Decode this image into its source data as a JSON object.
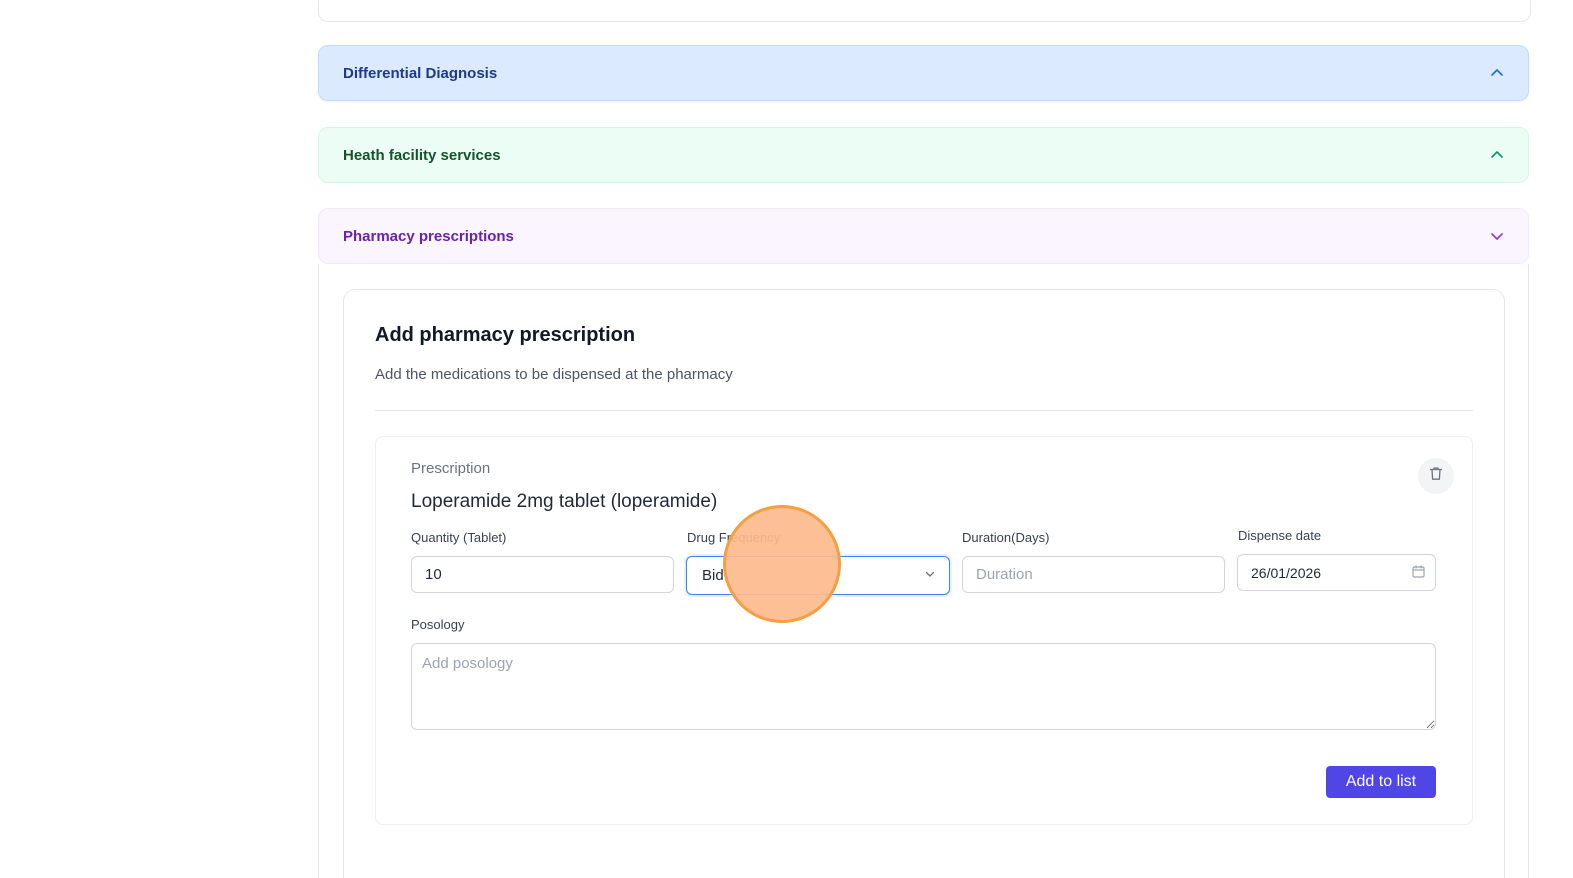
{
  "sections": {
    "differential_diagnosis": {
      "title": "Differential Diagnosis",
      "state": "collapsed"
    },
    "health_facility_services": {
      "title": "Heath facility services",
      "state": "collapsed"
    },
    "pharmacy_prescriptions": {
      "title": "Pharmacy prescriptions",
      "state": "expanded"
    }
  },
  "pharmacy": {
    "card_title": "Add pharmacy prescription",
    "card_subtitle": "Add the medications to be dispensed at the pharmacy",
    "prescription": {
      "label": "Prescription",
      "drug_name": "Loperamide 2mg tablet (loperamide)",
      "quantity": {
        "label": "Quantity (Tablet)",
        "value": "10"
      },
      "frequency": {
        "label": "Drug Frequency",
        "selected": "Bid"
      },
      "duration": {
        "label": "Duration(Days)",
        "placeholder": "Duration",
        "value": ""
      },
      "dispense_date": {
        "label": "Dispense date",
        "value": "26/01/2026"
      },
      "posology": {
        "label": "Posology",
        "placeholder": "Add posology",
        "value": ""
      }
    },
    "add_button_label": "Add to list"
  },
  "icons": {
    "collapse": "chevron-up-icon",
    "expand": "chevron-down-icon",
    "delete": "trash-icon",
    "calendar": "calendar-icon",
    "select": "chevron-down-icon"
  },
  "colors": {
    "diagnosis_bg": "#dbeafe",
    "diagnosis_text": "#1e3a8a",
    "services_bg": "#ecfdf5",
    "services_text": "#14532d",
    "pharmacy_bg": "#faf5ff",
    "pharmacy_text": "#6b21a8",
    "primary_button": "#4f46e5",
    "focus_border": "#3b82f6",
    "click_marker": "#f59e42"
  }
}
